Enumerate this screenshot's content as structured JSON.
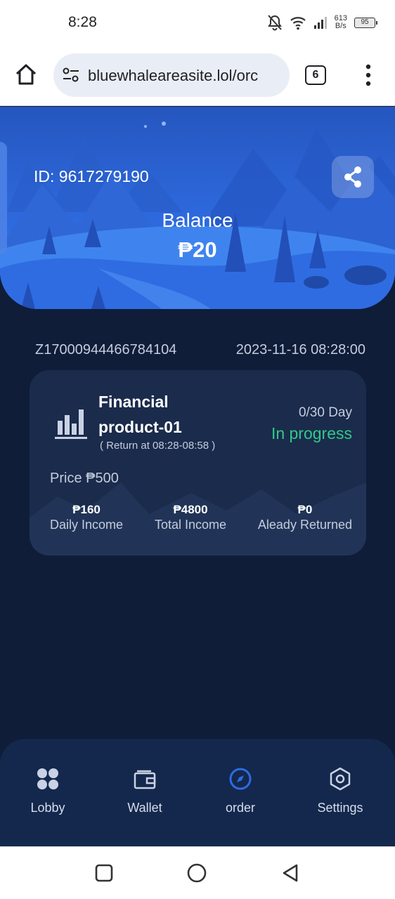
{
  "status_bar": {
    "time": "8:28",
    "net_speed_value": "613",
    "net_speed_unit": "B/s",
    "battery": "95",
    "icons": [
      "bell-off-icon",
      "wifi-icon",
      "signal-icon"
    ]
  },
  "browser": {
    "url": "bluewhaleareasite.lol/orc",
    "tab_count": "6",
    "icons": [
      "home-icon",
      "tune-icon",
      "more-vert-icon"
    ]
  },
  "hero": {
    "user_id": "ID: 9617279190",
    "balance_label": "Balance",
    "balance_value": "₱20",
    "share_icon": "share-icon"
  },
  "order": {
    "number": "Z17000944466784104",
    "datetime": "2023-11-16 08:28:00",
    "product_name": "Financial product-01",
    "return_at": "( Return at 08:28-08:58 )",
    "days": "0/30 Day",
    "status": "In progress",
    "price": "Price ₱500",
    "stats": [
      {
        "value": "₱160",
        "label": "Daily Income"
      },
      {
        "value": "₱4800",
        "label": "Total Income"
      },
      {
        "value": "₱0",
        "label": "Aleady Returned"
      }
    ]
  },
  "nav": {
    "items": [
      {
        "label": "Lobby",
        "icon": "lobby-icon"
      },
      {
        "label": "Wallet",
        "icon": "wallet-icon"
      },
      {
        "label": "order",
        "icon": "compass-icon"
      },
      {
        "label": "Settings",
        "icon": "settings-icon"
      }
    ],
    "active": "order"
  },
  "colors": {
    "accent": "#2e6be0",
    "page_bg": "#0f1d39",
    "card_bg": "#1a2b4c",
    "status_green": "#31c98a"
  }
}
